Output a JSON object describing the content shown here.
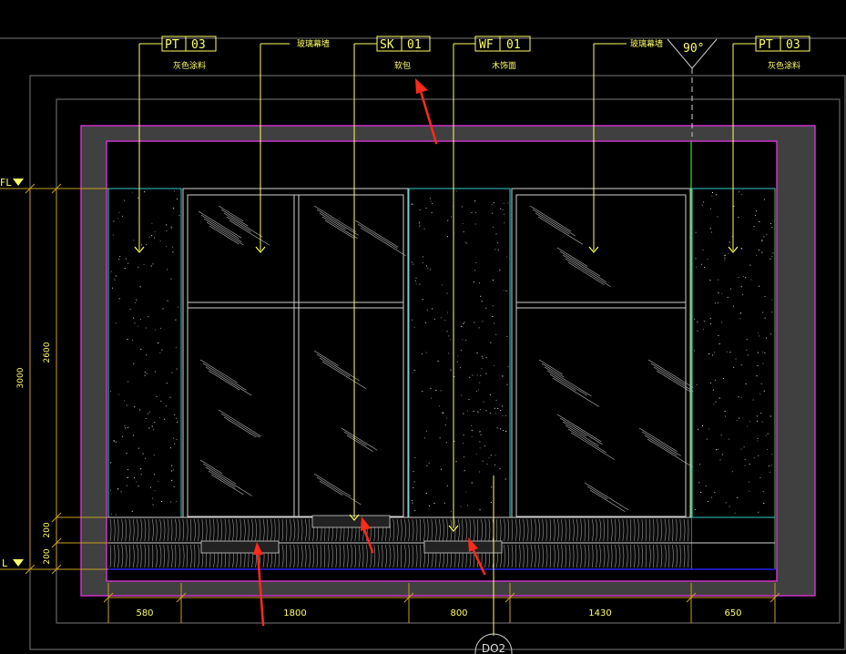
{
  "callouts": [
    {
      "code": "PT",
      "num": "03",
      "desc": "灰色涂料"
    },
    {
      "code": "",
      "num": "",
      "desc": "玻璃幕墙"
    },
    {
      "code": "SK",
      "num": "01",
      "desc": "软包"
    },
    {
      "code": "WF",
      "num": "01",
      "desc": "木饰面"
    },
    {
      "code": "",
      "num": "",
      "desc": "玻璃幕墙"
    },
    {
      "code": "PT",
      "num": "03",
      "desc": "灰色涂料"
    }
  ],
  "angle_label": "90°",
  "levels": {
    "top": "FL",
    "bottom": "L"
  },
  "vertical_dims": {
    "overall": "3000",
    "upper": "2600",
    "mid": "200",
    "lower": "200"
  },
  "horizontal_dims": [
    "580",
    "1800",
    "800",
    "1430",
    "650"
  ],
  "section_marker": "DO2",
  "colors": {
    "wall": "#404040",
    "magenta": "#cc33cc",
    "annotation": "#ffff66",
    "dim_line": "#c8a020",
    "glass": "#cfcfcf",
    "cyan": "#33cccc",
    "green": "#33dd33",
    "blue": "#2222ee",
    "arrow": "#ff2a1a"
  }
}
